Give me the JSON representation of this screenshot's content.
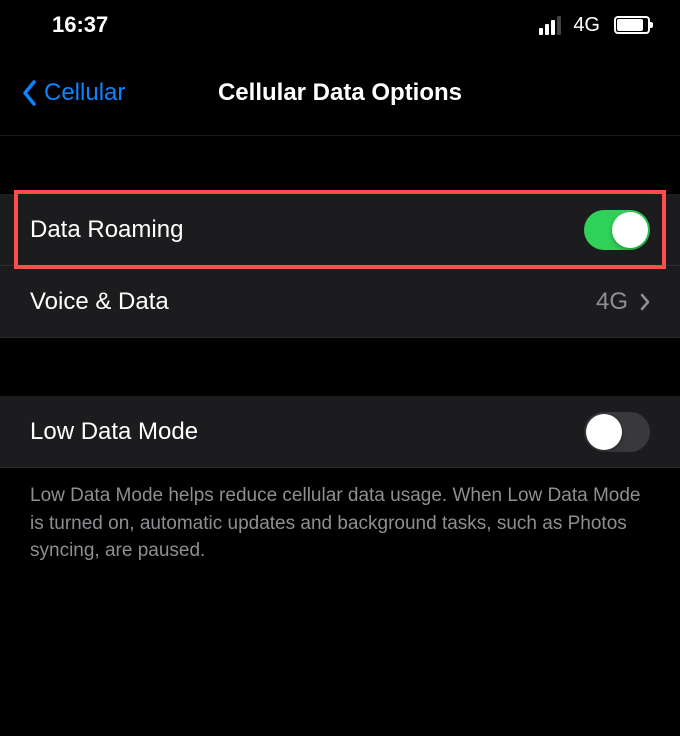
{
  "statusBar": {
    "time": "16:37",
    "networkLabel": "4G",
    "signalStrength": 3,
    "batteryLevel": 80
  },
  "nav": {
    "backLabel": "Cellular",
    "title": "Cellular Data Options"
  },
  "rows": {
    "dataRoaming": {
      "label": "Data Roaming",
      "enabled": true
    },
    "voiceData": {
      "label": "Voice & Data",
      "value": "4G"
    },
    "lowDataMode": {
      "label": "Low Data Mode",
      "enabled": false
    }
  },
  "footer": {
    "text": "Low Data Mode helps reduce cellular data usage. When Low Data Mode is turned on, automatic updates and background tasks, such as Photos syncing, are paused."
  },
  "highlight": {
    "color": "#ff4d4d",
    "target": "data-roaming"
  }
}
